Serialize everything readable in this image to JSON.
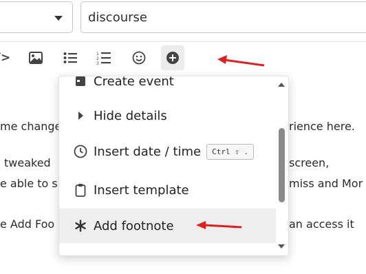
{
  "composer": {
    "tags_value": "discourse"
  },
  "toolbar": {
    "code_glyph": "/>"
  },
  "body_lines": [
    "me change",
    "rience here.",
    "tweaked",
    "screen,",
    "e able to s",
    "miss and Mor",
    "e Add Foo",
    "an access it"
  ],
  "insert_menu": {
    "items": [
      {
        "label": "Create event",
        "icon": "calendar-icon"
      },
      {
        "label": "Hide details",
        "icon": "caret-right-icon"
      },
      {
        "label": "Insert date / time",
        "icon": "clock-icon",
        "shortcut": "Ctrl ⇧ ."
      },
      {
        "label": "Insert template",
        "icon": "clipboard-icon"
      },
      {
        "label": "Add footnote",
        "icon": "asterisk-icon",
        "hovered": true
      }
    ]
  },
  "colors": {
    "annotation_arrow": "#e02020",
    "hover_background": "#eeeeee"
  }
}
